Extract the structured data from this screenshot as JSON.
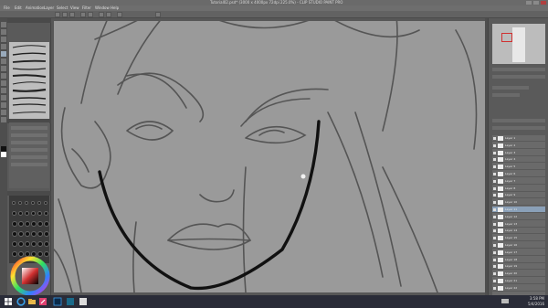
{
  "window": {
    "title": "Tutorial02.psd* (3000 x 4000px 72dpi 225.0%) - CLIP STUDIO PAINT PRO"
  },
  "menu": [
    "File",
    "Edit",
    "Animation",
    "Layer",
    "Select",
    "View",
    "Filter",
    "Window",
    "Help"
  ],
  "brush_panel": {
    "title": "G-pen"
  },
  "tool_property": {
    "title": "Tool property"
  },
  "layers": [
    "Layer 1",
    "Layer 2",
    "Layer 3",
    "Layer 4",
    "Layer 5",
    "Layer 6",
    "Layer 7",
    "Layer 8",
    "Layer 9",
    "Layer 10",
    "Layer 11",
    "Layer 12",
    "Layer 13",
    "Layer 14",
    "Layer 15",
    "Layer 16",
    "Layer 17",
    "Layer 18",
    "Layer 19",
    "Layer 20",
    "Layer 21",
    "Layer 22"
  ],
  "taskbar": {
    "time": "3:58 PM",
    "date": "5/4/2016"
  },
  "colors": {
    "canvas_bg": "#9a9a9a",
    "ui_panel": "#5a5a5a",
    "taskbar": "#2a2c38",
    "accent_selected": "#8aa0b8"
  },
  "icons": {
    "taskbar": [
      "windows-start-icon",
      "internet-explorer-icon",
      "folder-icon",
      "clip-studio-icon",
      "photoshop-icon",
      "media-icon",
      "skype-icon",
      "monitor-icon"
    ]
  }
}
